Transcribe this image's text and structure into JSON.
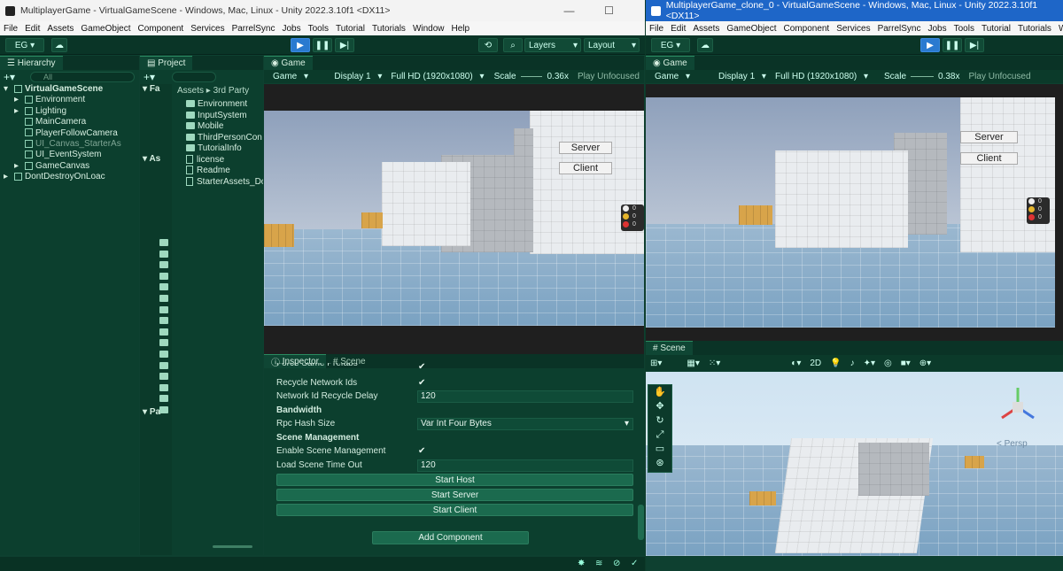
{
  "left_window": {
    "title": "MultiplayerGame - VirtualGameScene - Windows, Mac, Linux - Unity 2022.3.10f1 <DX11>",
    "menu": [
      "File",
      "Edit",
      "Assets",
      "GameObject",
      "Component",
      "Services",
      "ParrelSync",
      "Jobs",
      "Tools",
      "Tutorial",
      "Tutorials",
      "Window",
      "Help"
    ],
    "toolbar": {
      "account": "EG",
      "layers": "Layers",
      "layout": "Layout"
    },
    "hierarchy": {
      "tab": "Hierarchy",
      "search_placeholder": "All",
      "items": [
        {
          "label": "VirtualGameScene",
          "depth": 0
        },
        {
          "label": "Environment",
          "depth": 1
        },
        {
          "label": "Lighting",
          "depth": 1
        },
        {
          "label": "MainCamera",
          "depth": 1
        },
        {
          "label": "PlayerFollowCamera",
          "depth": 1
        },
        {
          "label": "UI_Canvas_StarterAs",
          "depth": 1
        },
        {
          "label": "UI_EventSystem",
          "depth": 1
        },
        {
          "label": "GameCanvas",
          "depth": 1
        },
        {
          "label": "DontDestroyOnLoac",
          "depth": 0
        }
      ]
    },
    "project": {
      "tab": "Project",
      "breadcrumb": [
        "Assets",
        "3rd Party"
      ],
      "left_items": [
        "Fa",
        "As",
        "Pa"
      ],
      "files": [
        "Environment",
        "InputSystem",
        "Mobile",
        "ThirdPersonCon",
        "TutorialInfo",
        "license",
        "Readme",
        "StarterAssets_Do"
      ]
    },
    "game": {
      "tab": "Game",
      "mode": "Game",
      "display": "Display 1",
      "resolution": "Full HD (1920x1080)",
      "scale_label": "Scale",
      "scale": "0.36x",
      "play": "Play Unfocused",
      "buttons": [
        "Server",
        "Client"
      ],
      "stats": [
        "0",
        "0",
        "0"
      ]
    },
    "inspector": {
      "tabs": [
        "Inspector",
        "Scene"
      ],
      "rows": [
        {
          "label": "Force Same Prefabs",
          "type": "check"
        },
        {
          "label": "Recycle Network Ids",
          "type": "check"
        },
        {
          "label": "Network Id Recycle Delay",
          "value": "120"
        },
        {
          "label": "Bandwidth",
          "type": "header"
        },
        {
          "label": "Rpc Hash Size",
          "value": "Var Int Four Bytes"
        },
        {
          "label": "Scene Management",
          "type": "header"
        },
        {
          "label": "Enable Scene Management",
          "type": "check"
        },
        {
          "label": "Load Scene Time Out",
          "value": "120"
        }
      ],
      "buttons": [
        "Start Host",
        "Start Server",
        "Start Client"
      ],
      "add_component": "Add Component"
    }
  },
  "right_window": {
    "title": "MultiplayerGame_clone_0 - VirtualGameScene - Windows, Mac, Linux - Unity 2022.3.10f1 <DX11>",
    "menu": [
      "File",
      "Edit",
      "Assets",
      "GameObject",
      "Component",
      "Services",
      "ParrelSync",
      "Jobs",
      "Tools",
      "Tutorial",
      "Tutorials",
      "Window"
    ],
    "toolbar": {
      "account": "EG"
    },
    "game": {
      "tab": "Game",
      "mode": "Game",
      "display": "Display 1",
      "resolution": "Full HD (1920x1080)",
      "scale_label": "Scale",
      "scale": "0.38x",
      "play": "Play Unfocused",
      "buttons": [
        "Server",
        "Client"
      ],
      "stats": [
        "0",
        "0",
        "0"
      ]
    },
    "scene": {
      "tab": "Scene",
      "mode_2d": "2D",
      "persp": "< Persp"
    }
  },
  "colors": {
    "editor_bg": "#0c3f2e",
    "play_blue": "#2a7ad0",
    "title_blue": "#1e66c8"
  }
}
